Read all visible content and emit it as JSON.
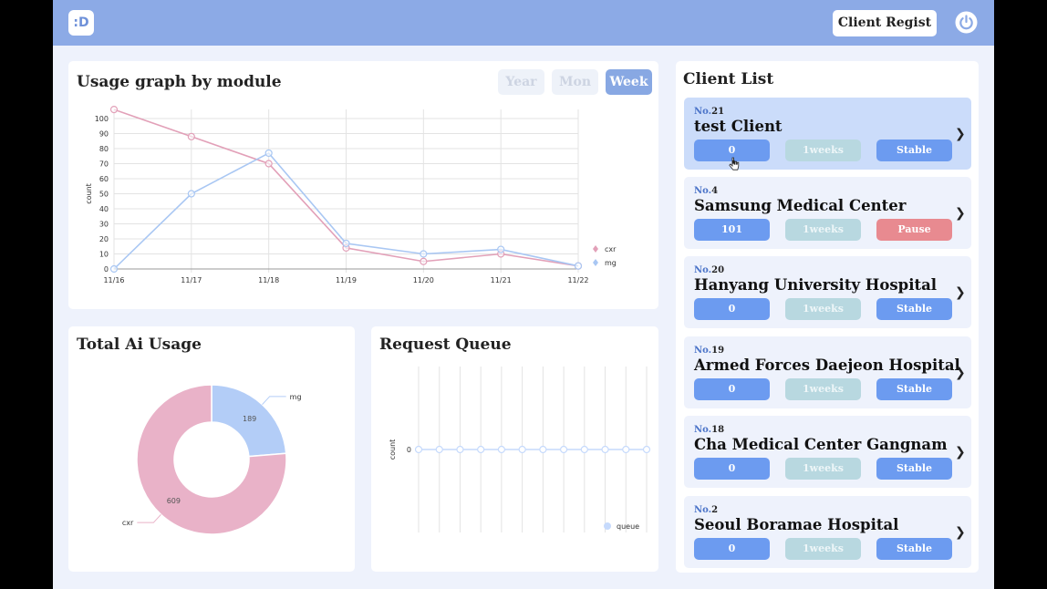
{
  "header": {
    "logo": ":D",
    "regist_label": "Client Regist"
  },
  "usage_card": {
    "title": "Usage graph by module",
    "periods": [
      {
        "label": "Year",
        "active": false
      },
      {
        "label": "Mon",
        "active": false
      },
      {
        "label": "Week",
        "active": true
      }
    ]
  },
  "total_card": {
    "title": "Total Ai Usage"
  },
  "queue_card": {
    "title": "Request Queue"
  },
  "client_list": {
    "title": "Client List",
    "no_prefix": "No.",
    "items": [
      {
        "no": "21",
        "name": "test Client",
        "count": "0",
        "period": "1weeks",
        "status": "Stable",
        "status_color": "#6c9bf0",
        "active": true
      },
      {
        "no": "4",
        "name": "Samsung Medical Center",
        "count": "101",
        "period": "1weeks",
        "status": "Pause",
        "status_color": "#e88a90",
        "active": false
      },
      {
        "no": "20",
        "name": "Hanyang University Hospital",
        "count": "0",
        "period": "1weeks",
        "status": "Stable",
        "status_color": "#6c9bf0",
        "active": false
      },
      {
        "no": "19",
        "name": "Armed Forces Daejeon Hospital",
        "count": "0",
        "period": "1weeks",
        "status": "Stable",
        "status_color": "#6c9bf0",
        "active": false
      },
      {
        "no": "18",
        "name": "Cha Medical Center Gangnam",
        "count": "0",
        "period": "1weeks",
        "status": "Stable",
        "status_color": "#6c9bf0",
        "active": false
      },
      {
        "no": "2",
        "name": "Seoul Boramae Hospital",
        "count": "0",
        "period": "1weeks",
        "status": "Stable",
        "status_color": "#6c9bf0",
        "active": false
      }
    ]
  },
  "colors": {
    "accent": "#8caae6",
    "cxr": "#e2a0b8",
    "mg": "#a9c7f3",
    "queue": "#c6dafc"
  },
  "chart_data": [
    {
      "type": "line",
      "title": "",
      "xlabel": "",
      "ylabel": "count",
      "x": [
        "11/16",
        "11/17",
        "11/18",
        "11/19",
        "11/20",
        "11/21",
        "11/22"
      ],
      "ylim": [
        0,
        100
      ],
      "yticks": [
        0,
        10,
        20,
        30,
        40,
        50,
        60,
        70,
        80,
        90,
        100
      ],
      "legend": "right",
      "grid": true,
      "series": [
        {
          "name": "cxr",
          "color": "#e2a0b8",
          "values": [
            106,
            88,
            70,
            14,
            5,
            10,
            2
          ]
        },
        {
          "name": "mg",
          "color": "#a9c7f3",
          "values": [
            0,
            50,
            77,
            17,
            10,
            13,
            2
          ]
        }
      ]
    },
    {
      "type": "pie",
      "donut": true,
      "slices": [
        {
          "name": "mg",
          "value": 189,
          "color": "#b3cdf7"
        },
        {
          "name": "cxr",
          "value": 609,
          "color": "#e9b2c8"
        }
      ]
    },
    {
      "type": "line",
      "ylabel": "count",
      "yticks": [
        0
      ],
      "legend": "bottom-right",
      "series": [
        {
          "name": "queue",
          "color": "#c6dafc",
          "values": [
            0,
            0,
            0,
            0,
            0,
            0,
            0,
            0,
            0,
            0,
            0,
            0
          ]
        }
      ]
    }
  ]
}
